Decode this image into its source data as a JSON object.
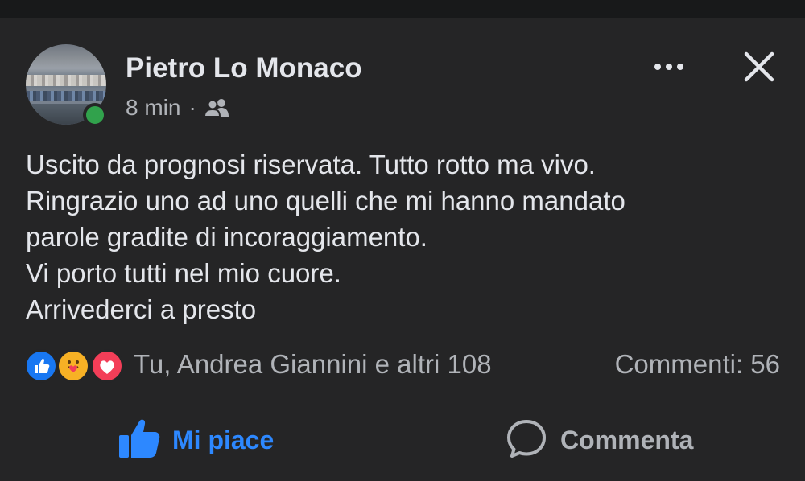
{
  "post": {
    "author": "Pietro Lo Monaco",
    "time": "8 min",
    "separator": "·",
    "audience_icon": "friends-icon",
    "text_lines": [
      "Uscito da prognosi riservata. Tutto rotto ma vivo.",
      "Ringrazio uno ad uno quelli che mi hanno mandato",
      "parole gradite di incoraggiamento.",
      "Vi porto tutti nel mio cuore.",
      "Arrivederci a presto"
    ]
  },
  "reactions": {
    "icons": [
      "like-reaction-icon",
      "care-reaction-icon",
      "love-reaction-icon"
    ],
    "summary": "Tu, Andrea Giannini e altri 108",
    "comments": "Commenti: 56"
  },
  "actions": {
    "like_label": "Mi piace",
    "comment_label": "Commenta"
  },
  "colors": {
    "background": "#252526",
    "online": "#31a24c",
    "like_active": "#2d88ff",
    "love": "#f33e58",
    "care": "#f7b125"
  }
}
